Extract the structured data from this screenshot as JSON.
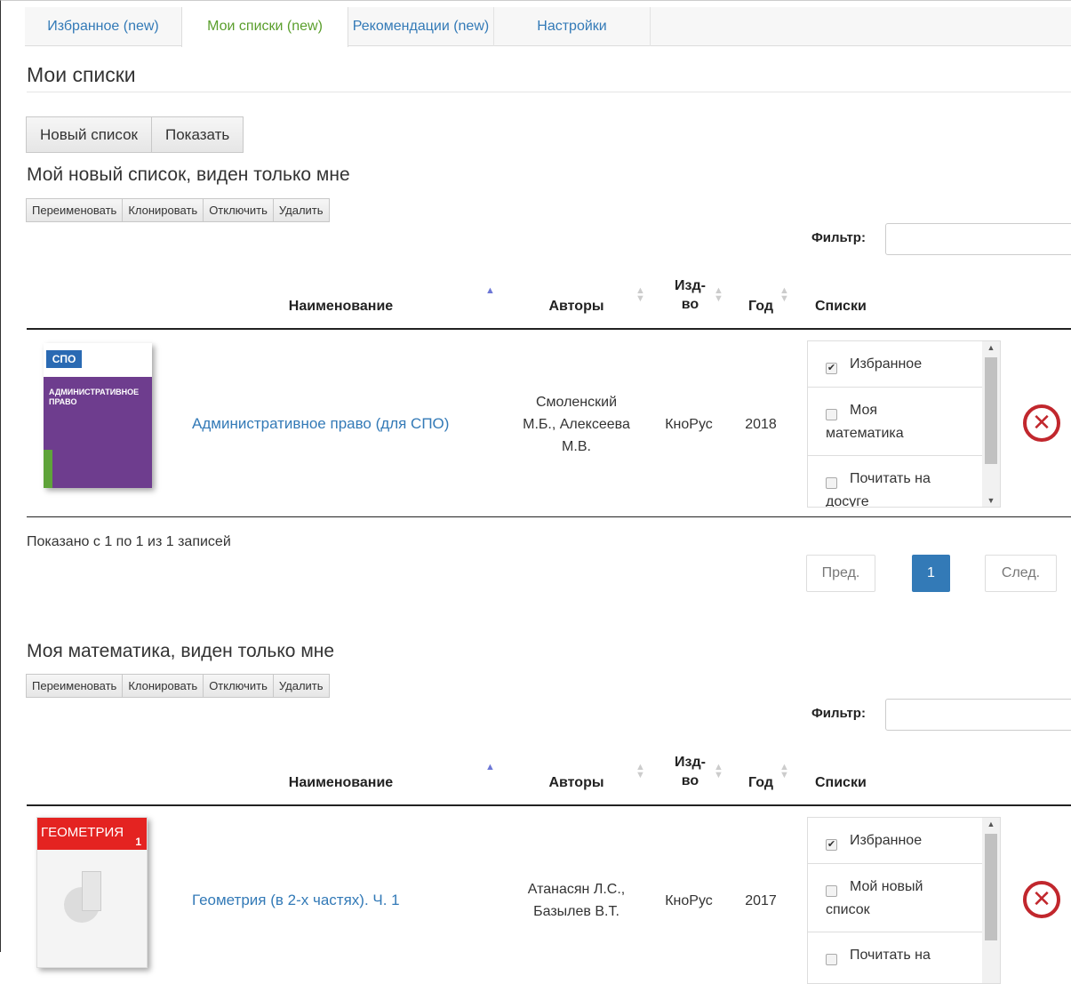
{
  "tabs": [
    {
      "label": "Избранное (new)"
    },
    {
      "label": "Мои списки (new)"
    },
    {
      "label": "Рекомендации (new)"
    },
    {
      "label": "Настройки"
    }
  ],
  "page_title": "Мои списки",
  "toolbar": {
    "new_list": "Новый список",
    "show": "Показать"
  },
  "list_actions": {
    "rename": "Переименовать",
    "clone": "Клонировать",
    "disable": "Отключить",
    "delete": "Удалить"
  },
  "filter_label": "Фильтр:",
  "columns": {
    "name": "Наименование",
    "authors": "Авторы",
    "publisher_1": "Изд-",
    "publisher_2": "во",
    "year": "Год",
    "lists": "Списки"
  },
  "colors": {
    "accent": "#337ab7",
    "active_tab": "#5a9e2c",
    "remove": "#c1272d"
  },
  "lists": [
    {
      "title": "Мой новый список, виден только мне",
      "rows": [
        {
          "cover_text": "АДМИНИСТРАТИВНОЕ ПРАВО",
          "cover_badge": "СПО",
          "name": "Административное право (для СПО)",
          "authors": [
            "Смоленский",
            "М.Б., Алексеева",
            "М.В."
          ],
          "publisher": "КноРус",
          "year": "2018",
          "lists": [
            {
              "label": "Избранное",
              "checked": true
            },
            {
              "label_1": "Моя",
              "label_2": "математика",
              "checked": false
            },
            {
              "label_1": "Почитать на",
              "label_2": "досуге",
              "checked": false
            }
          ]
        }
      ],
      "info": "Показано с 1 по 1 из 1 записей",
      "pagination": {
        "prev": "Пред.",
        "current": "1",
        "next": "След."
      }
    },
    {
      "title": "Моя математика, виден только мне",
      "rows": [
        {
          "cover_text": "ГЕОМЕТРИЯ",
          "cover_num": "1",
          "name": "Геометрия (в 2-х частях). Ч. 1",
          "authors": [
            "Атанасян Л.С.,",
            "Базылев В.Т."
          ],
          "publisher": "КноРус",
          "year": "2017",
          "lists": [
            {
              "label": "Избранное",
              "checked": true
            },
            {
              "label_1": "Мой новый",
              "label_2": "список",
              "checked": false
            },
            {
              "label_1": "Почитать на",
              "checked": false
            }
          ]
        }
      ]
    }
  ]
}
